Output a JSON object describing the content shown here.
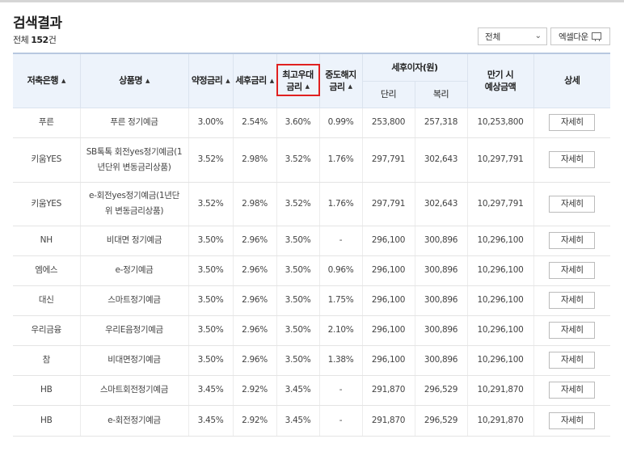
{
  "title": "검색결과",
  "count": {
    "prefix": "전체",
    "value": "152",
    "suffix": "건"
  },
  "filter": {
    "selected": "전체"
  },
  "excel_button": "엑셀다운",
  "headers": {
    "bank": "저축은행",
    "product": "상품명",
    "base_rate": "약정금리",
    "after_tax_rate": "세후금리",
    "max_rate_line1": "최고우대",
    "max_rate_line2": "금리",
    "early_rate_line1": "중도해지",
    "early_rate_line2": "금리",
    "interest_group": "세후이자(원)",
    "simple": "단리",
    "compound": "복리",
    "maturity_line1": "만기 시",
    "maturity_line2": "예상금액",
    "detail": "상세"
  },
  "detail_label": "자세히",
  "rows": [
    {
      "bank": "푸른",
      "product": "푸른 정기예금",
      "base": "3.00%",
      "after_tax": "2.54%",
      "max": "3.60%",
      "early": "0.99%",
      "simple": "253,800",
      "compound": "257,318",
      "maturity": "10,253,800"
    },
    {
      "bank": "키움YES",
      "product": "SB톡톡 회전yes정기예금(1년단위 변동금리상품)",
      "base": "3.52%",
      "after_tax": "2.98%",
      "max": "3.52%",
      "early": "1.76%",
      "simple": "297,791",
      "compound": "302,643",
      "maturity": "10,297,791"
    },
    {
      "bank": "키움YES",
      "product": "e-회전yes정기예금(1년단위 변동금리상품)",
      "base": "3.52%",
      "after_tax": "2.98%",
      "max": "3.52%",
      "early": "1.76%",
      "simple": "297,791",
      "compound": "302,643",
      "maturity": "10,297,791"
    },
    {
      "bank": "NH",
      "product": "비대면 정기예금",
      "base": "3.50%",
      "after_tax": "2.96%",
      "max": "3.50%",
      "early": "-",
      "simple": "296,100",
      "compound": "300,896",
      "maturity": "10,296,100"
    },
    {
      "bank": "엠에스",
      "product": "e-정기예금",
      "base": "3.50%",
      "after_tax": "2.96%",
      "max": "3.50%",
      "early": "0.96%",
      "simple": "296,100",
      "compound": "300,896",
      "maturity": "10,296,100"
    },
    {
      "bank": "대신",
      "product": "스마트정기예금",
      "base": "3.50%",
      "after_tax": "2.96%",
      "max": "3.50%",
      "early": "1.75%",
      "simple": "296,100",
      "compound": "300,896",
      "maturity": "10,296,100"
    },
    {
      "bank": "우리금융",
      "product": "우리E음정기예금",
      "base": "3.50%",
      "after_tax": "2.96%",
      "max": "3.50%",
      "early": "2.10%",
      "simple": "296,100",
      "compound": "300,896",
      "maturity": "10,296,100"
    },
    {
      "bank": "참",
      "product": "비대면정기예금",
      "base": "3.50%",
      "after_tax": "2.96%",
      "max": "3.50%",
      "early": "1.38%",
      "simple": "296,100",
      "compound": "300,896",
      "maturity": "10,296,100"
    },
    {
      "bank": "HB",
      "product": "스마트회전정기예금",
      "base": "3.45%",
      "after_tax": "2.92%",
      "max": "3.45%",
      "early": "-",
      "simple": "291,870",
      "compound": "296,529",
      "maturity": "10,291,870"
    },
    {
      "bank": "HB",
      "product": "e-회전정기예금",
      "base": "3.45%",
      "after_tax": "2.92%",
      "max": "3.45%",
      "early": "-",
      "simple": "291,870",
      "compound": "296,529",
      "maturity": "10,291,870"
    }
  ],
  "icons": {
    "sort": "sort-asc-icon",
    "dropdown": "chevron-down-icon",
    "excel": "monitor-download-icon"
  },
  "colors": {
    "highlight": "#e02020",
    "header_bg": "#edf3fb"
  }
}
